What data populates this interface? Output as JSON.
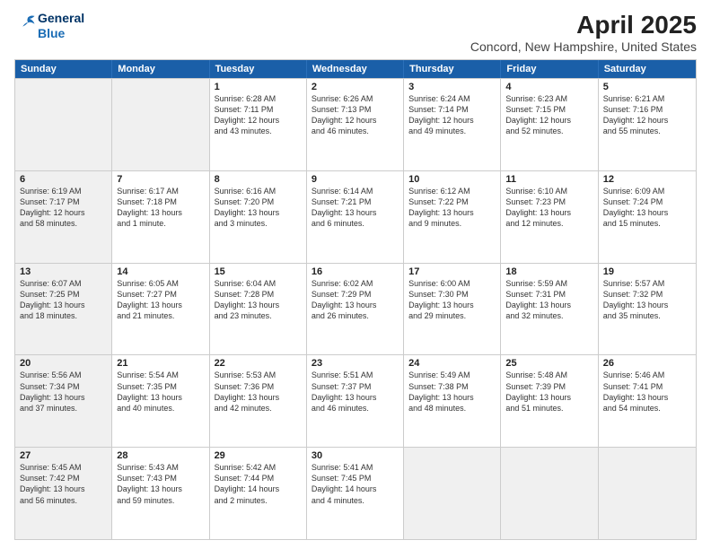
{
  "logo": {
    "line1": "General",
    "line2": "Blue"
  },
  "title": "April 2025",
  "subtitle": "Concord, New Hampshire, United States",
  "header_days": [
    "Sunday",
    "Monday",
    "Tuesday",
    "Wednesday",
    "Thursday",
    "Friday",
    "Saturday"
  ],
  "weeks": [
    [
      {
        "day": "",
        "text": "",
        "shaded": true
      },
      {
        "day": "",
        "text": "",
        "shaded": true
      },
      {
        "day": "1",
        "text": "Sunrise: 6:28 AM\nSunset: 7:11 PM\nDaylight: 12 hours\nand 43 minutes.",
        "shaded": false
      },
      {
        "day": "2",
        "text": "Sunrise: 6:26 AM\nSunset: 7:13 PM\nDaylight: 12 hours\nand 46 minutes.",
        "shaded": false
      },
      {
        "day": "3",
        "text": "Sunrise: 6:24 AM\nSunset: 7:14 PM\nDaylight: 12 hours\nand 49 minutes.",
        "shaded": false
      },
      {
        "day": "4",
        "text": "Sunrise: 6:23 AM\nSunset: 7:15 PM\nDaylight: 12 hours\nand 52 minutes.",
        "shaded": false
      },
      {
        "day": "5",
        "text": "Sunrise: 6:21 AM\nSunset: 7:16 PM\nDaylight: 12 hours\nand 55 minutes.",
        "shaded": false
      }
    ],
    [
      {
        "day": "6",
        "text": "Sunrise: 6:19 AM\nSunset: 7:17 PM\nDaylight: 12 hours\nand 58 minutes.",
        "shaded": true
      },
      {
        "day": "7",
        "text": "Sunrise: 6:17 AM\nSunset: 7:18 PM\nDaylight: 13 hours\nand 1 minute.",
        "shaded": false
      },
      {
        "day": "8",
        "text": "Sunrise: 6:16 AM\nSunset: 7:20 PM\nDaylight: 13 hours\nand 3 minutes.",
        "shaded": false
      },
      {
        "day": "9",
        "text": "Sunrise: 6:14 AM\nSunset: 7:21 PM\nDaylight: 13 hours\nand 6 minutes.",
        "shaded": false
      },
      {
        "day": "10",
        "text": "Sunrise: 6:12 AM\nSunset: 7:22 PM\nDaylight: 13 hours\nand 9 minutes.",
        "shaded": false
      },
      {
        "day": "11",
        "text": "Sunrise: 6:10 AM\nSunset: 7:23 PM\nDaylight: 13 hours\nand 12 minutes.",
        "shaded": false
      },
      {
        "day": "12",
        "text": "Sunrise: 6:09 AM\nSunset: 7:24 PM\nDaylight: 13 hours\nand 15 minutes.",
        "shaded": false
      }
    ],
    [
      {
        "day": "13",
        "text": "Sunrise: 6:07 AM\nSunset: 7:25 PM\nDaylight: 13 hours\nand 18 minutes.",
        "shaded": true
      },
      {
        "day": "14",
        "text": "Sunrise: 6:05 AM\nSunset: 7:27 PM\nDaylight: 13 hours\nand 21 minutes.",
        "shaded": false
      },
      {
        "day": "15",
        "text": "Sunrise: 6:04 AM\nSunset: 7:28 PM\nDaylight: 13 hours\nand 23 minutes.",
        "shaded": false
      },
      {
        "day": "16",
        "text": "Sunrise: 6:02 AM\nSunset: 7:29 PM\nDaylight: 13 hours\nand 26 minutes.",
        "shaded": false
      },
      {
        "day": "17",
        "text": "Sunrise: 6:00 AM\nSunset: 7:30 PM\nDaylight: 13 hours\nand 29 minutes.",
        "shaded": false
      },
      {
        "day": "18",
        "text": "Sunrise: 5:59 AM\nSunset: 7:31 PM\nDaylight: 13 hours\nand 32 minutes.",
        "shaded": false
      },
      {
        "day": "19",
        "text": "Sunrise: 5:57 AM\nSunset: 7:32 PM\nDaylight: 13 hours\nand 35 minutes.",
        "shaded": false
      }
    ],
    [
      {
        "day": "20",
        "text": "Sunrise: 5:56 AM\nSunset: 7:34 PM\nDaylight: 13 hours\nand 37 minutes.",
        "shaded": true
      },
      {
        "day": "21",
        "text": "Sunrise: 5:54 AM\nSunset: 7:35 PM\nDaylight: 13 hours\nand 40 minutes.",
        "shaded": false
      },
      {
        "day": "22",
        "text": "Sunrise: 5:53 AM\nSunset: 7:36 PM\nDaylight: 13 hours\nand 42 minutes.",
        "shaded": false
      },
      {
        "day": "23",
        "text": "Sunrise: 5:51 AM\nSunset: 7:37 PM\nDaylight: 13 hours\nand 46 minutes.",
        "shaded": false
      },
      {
        "day": "24",
        "text": "Sunrise: 5:49 AM\nSunset: 7:38 PM\nDaylight: 13 hours\nand 48 minutes.",
        "shaded": false
      },
      {
        "day": "25",
        "text": "Sunrise: 5:48 AM\nSunset: 7:39 PM\nDaylight: 13 hours\nand 51 minutes.",
        "shaded": false
      },
      {
        "day": "26",
        "text": "Sunrise: 5:46 AM\nSunset: 7:41 PM\nDaylight: 13 hours\nand 54 minutes.",
        "shaded": false
      }
    ],
    [
      {
        "day": "27",
        "text": "Sunrise: 5:45 AM\nSunset: 7:42 PM\nDaylight: 13 hours\nand 56 minutes.",
        "shaded": true
      },
      {
        "day": "28",
        "text": "Sunrise: 5:43 AM\nSunset: 7:43 PM\nDaylight: 13 hours\nand 59 minutes.",
        "shaded": false
      },
      {
        "day": "29",
        "text": "Sunrise: 5:42 AM\nSunset: 7:44 PM\nDaylight: 14 hours\nand 2 minutes.",
        "shaded": false
      },
      {
        "day": "30",
        "text": "Sunrise: 5:41 AM\nSunset: 7:45 PM\nDaylight: 14 hours\nand 4 minutes.",
        "shaded": false
      },
      {
        "day": "",
        "text": "",
        "shaded": true
      },
      {
        "day": "",
        "text": "",
        "shaded": true
      },
      {
        "day": "",
        "text": "",
        "shaded": true
      }
    ]
  ]
}
